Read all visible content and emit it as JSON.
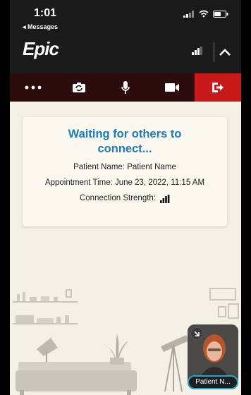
{
  "status_bar": {
    "time": "1:01",
    "back_label": "◂ Messages"
  },
  "header": {
    "logo_text": "Epic",
    "connection_bars_filled": 3
  },
  "toolbar": {
    "buttons": [
      {
        "id": "more",
        "icon": "ellipsis-icon"
      },
      {
        "id": "flip-camera",
        "icon": "camera-switch-icon"
      },
      {
        "id": "microphone",
        "icon": "microphone-icon"
      },
      {
        "id": "video",
        "icon": "video-camera-icon"
      },
      {
        "id": "leave",
        "icon": "exit-icon"
      }
    ],
    "leave_color": "#c81a1a"
  },
  "card": {
    "title": "Waiting for others to connect...",
    "patient_line": "Patient Name: Patient Name",
    "appointment_line": "Appointment Time: June 23, 2022, 11:15 AM",
    "connection_label": "Connection Strength:",
    "connection_bars_filled": 3
  },
  "self_view": {
    "name_label": "Patient N..."
  },
  "colors": {
    "accent": "#1e7ab8",
    "header": "#1a1a1a",
    "toolbar": "#2c0c0c",
    "background": "#f3f0e6",
    "name_pill_border": "#2aa3c4"
  }
}
